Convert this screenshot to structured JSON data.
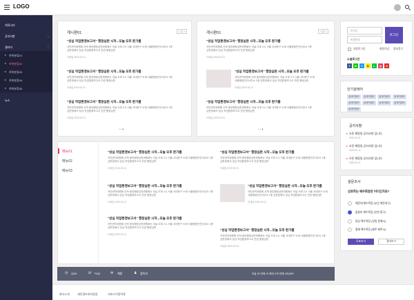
{
  "header": {
    "logo": "LOGO"
  },
  "sidebar": {
    "items": [
      "커뮤니티",
      "공지사항",
      "갤러리"
    ],
    "subs": [
      "하위분류01",
      "하위분류02",
      "하위분류03",
      "하위분류04",
      "하위분류05"
    ],
    "news": "뉴스"
  },
  "board1": {
    "title": "게시판01",
    "posts": [
      {
        "title": "\"성심 작업환경보고서\" 행정심판 시작...오늘 오후 판가름",
        "text": "국민권익위원회 산하 중앙행정심판위원회는 이날 오후 2시 서울 서대문구 소재 서울행정안전사무소 1층 심판정에서 성심 작업환경보고서 관련 행정심판",
        "date": "닉네임  2020.02.11"
      },
      {
        "title": "\"성심 작업환경보고서\" 행정심판 시작...오늘 오후 판가름",
        "text": "국민권익위원회 산하 중앙행정심판위원회는 이날 오후 2시 서울 서대문구 소재 서울행정안전사무소 1층 심판정에서 성심 작업환경보고서 관련 행정심판",
        "date": "닉네임  2020.02.11"
      },
      {
        "title": "\"성심 작업환경보고서\" 행정심판 시작...오늘 오후 판가름",
        "text": "국민권익위원회 산하 중앙행정심판위원회는 이날 오후 2시 서울 서대문구 소재 서울행정안전사무소 1층 심판정에서 성심 작업환경보고서 관련 행정심판",
        "date": "닉네임  2020.02.11"
      }
    ]
  },
  "board2": {
    "title": "게시판01",
    "posts": [
      {
        "title": "\"성심 작업환경보고서\" 행정심판 시작...오늘 오후 판가름",
        "text": "국민권익위원회 산하 중앙행정심판위원회는 이날 오후 2시 서울 서대문구 소재 서울행정안전사무소 1층 심판정에서 성심 작업환경보고서 관련 행정심판",
        "date": "닉네임  2020.02.11"
      },
      {
        "title": "\"성심 작업환경보고서\" 행정심판 시작...오늘 오후 판가름",
        "text": "국민권익위원회 산하 중앙행정심판위원회는 이날 오후 2시 서울 서대문구 소재 서울행정안전사무소 1층 심판정에서 성심 작업환경보고서 관련 행정심판",
        "date": "닉네임  2020.02.11"
      },
      {
        "title": "\"성심 작업환경보고서\" 행정심판 시작...오늘 오후 판가름",
        "text": "국민권익위원회 산하 중앙행정심판위원회는 이날 오후 2시 서울 서대문구 소재 서울행정안전사무소 1층 심판정에서 성심 작업환경보고서 관련 행정심판",
        "date": "닉네임  2020.02.11"
      }
    ]
  },
  "menus": {
    "tabs": [
      "메뉴01",
      "메뉴02",
      "메뉴03"
    ],
    "posts": [
      {
        "title": "\"성심 작업환경보고서\" 행정심판 시작...오늘 오후 판가름",
        "text": "국민권익위원회 산하 중앙행정심판위원회는 이날 오후 2시 서울 서대문구 소재 서울행정안전사무소 1층 심판정에서 성심 작업환경보고서 관련 행정심판",
        "date": "닉네임  2020.02.11"
      },
      {
        "title": "\"성심 작업환경보고서\" 행정심판 시작...오늘 오후 판가름",
        "text": "국민권익위원회 산하 중앙행정심판위원회는 이날 오후 2시 서울 서대문구 소재 서울행정안전사무소 1층 심판정에서 성심 작업환경보고서 관련 행정심판",
        "date": "닉네임  2020.02.11"
      },
      {
        "title": "\"성심 작업환경보고서\" 행정심판 시작...오늘 오후 판가름",
        "text": "국민권익위원회 산하 중앙행정심판위원회는 이날 오후 2시 서울 서대문구 소재 서울행정안전사무소 1층 심판정에서 성심 작업환경보고서 관련 행정심판",
        "date": "닉네임  2020.02.11"
      },
      {
        "title": "\"성심 작업환경보고서\" 행정심판 시작...오늘 오후 판가름",
        "text": "국민권익위원회 산하 중앙행정심판위원회는 이날 오후 2시 서울 서대문구 소재 서울행정안전사무소 1층 심판정에서 성심 작업환경보고서 관련 행정심판",
        "date": "닉네임  2020.02.11"
      },
      {
        "title": "\"성심 작업환경보고서\" 행정심판 시작...오늘 오후 판가름",
        "text": "국민권익위원회 산하 중앙행정심판위원회는 이날 오후 2시 서울 서대문구 소재 서울행정안전사무소 1층 심판정에서 성심 작업환경보고서 관련 행정심판",
        "date": "닉네임  2020.02.11"
      },
      {
        "title": "\"성심 작업환경보고서\" 행정심판 시작...오늘 오후 판가름",
        "text": "국민권익위원회 산하 중앙행정심판위원회는 이날 오후 2시 서울 서대문구 소재 서울행정안전사무소 1층 심판정에서 성심 작업환경보고서 관련 행정심판",
        "date": "닉네임  2020.02.11"
      }
    ]
  },
  "login": {
    "id_placeholder": "아이디",
    "pw_placeholder": "비밀번호",
    "button": "로그인",
    "auto": "자동로그인",
    "join": "회원가입",
    "find": "정보찾기",
    "sns_title": "소셜로그인"
  },
  "keywords": {
    "title": "인기검색어",
    "tags": [
      "검색키워드",
      "검색키워드",
      "검색키워드",
      "검색키워드",
      "검색키워드",
      "검색키워드",
      "검색키워드",
      "검색키워드",
      "검색키워드"
    ]
  },
  "notice": {
    "title": "공지사항",
    "items": [
      {
        "text": "오픈 예정일 공지사항 입니다.",
        "date": "2020.02.11"
      },
      {
        "text": "오픈 예정일 공지사항 입니다.",
        "date": "2020.02.11"
      },
      {
        "text": "오픈 예정일 공지사항 입니다.",
        "date": "2020.02.11"
      }
    ]
  },
  "poll": {
    "title": "설문조사",
    "question": "선호하는 예수회장은 어디인가요?",
    "options": [
      "해운대 해수욕장 (부산 해운대구)",
      "을왕리 해수욕장 (인천 중구)",
      "망상 해수욕장 (강원 동해시)",
      "협재 해수욕장 (제주 제주시)"
    ],
    "vote": "투표하기",
    "result": "결과보기"
  },
  "footbar": {
    "links": [
      "Q&A",
      "FAQ",
      "채용",
      "접속자"
    ],
    "stats": "오늘  30   어제  19   최대  475   전체  135,800"
  },
  "footer": {
    "links": [
      "회사소개",
      "개인정보처리방침",
      "서비스이용약관"
    ]
  },
  "colors": {
    "sidebar": "#272a45",
    "accent": "#e8336a",
    "primary": "#5b4cb5"
  }
}
